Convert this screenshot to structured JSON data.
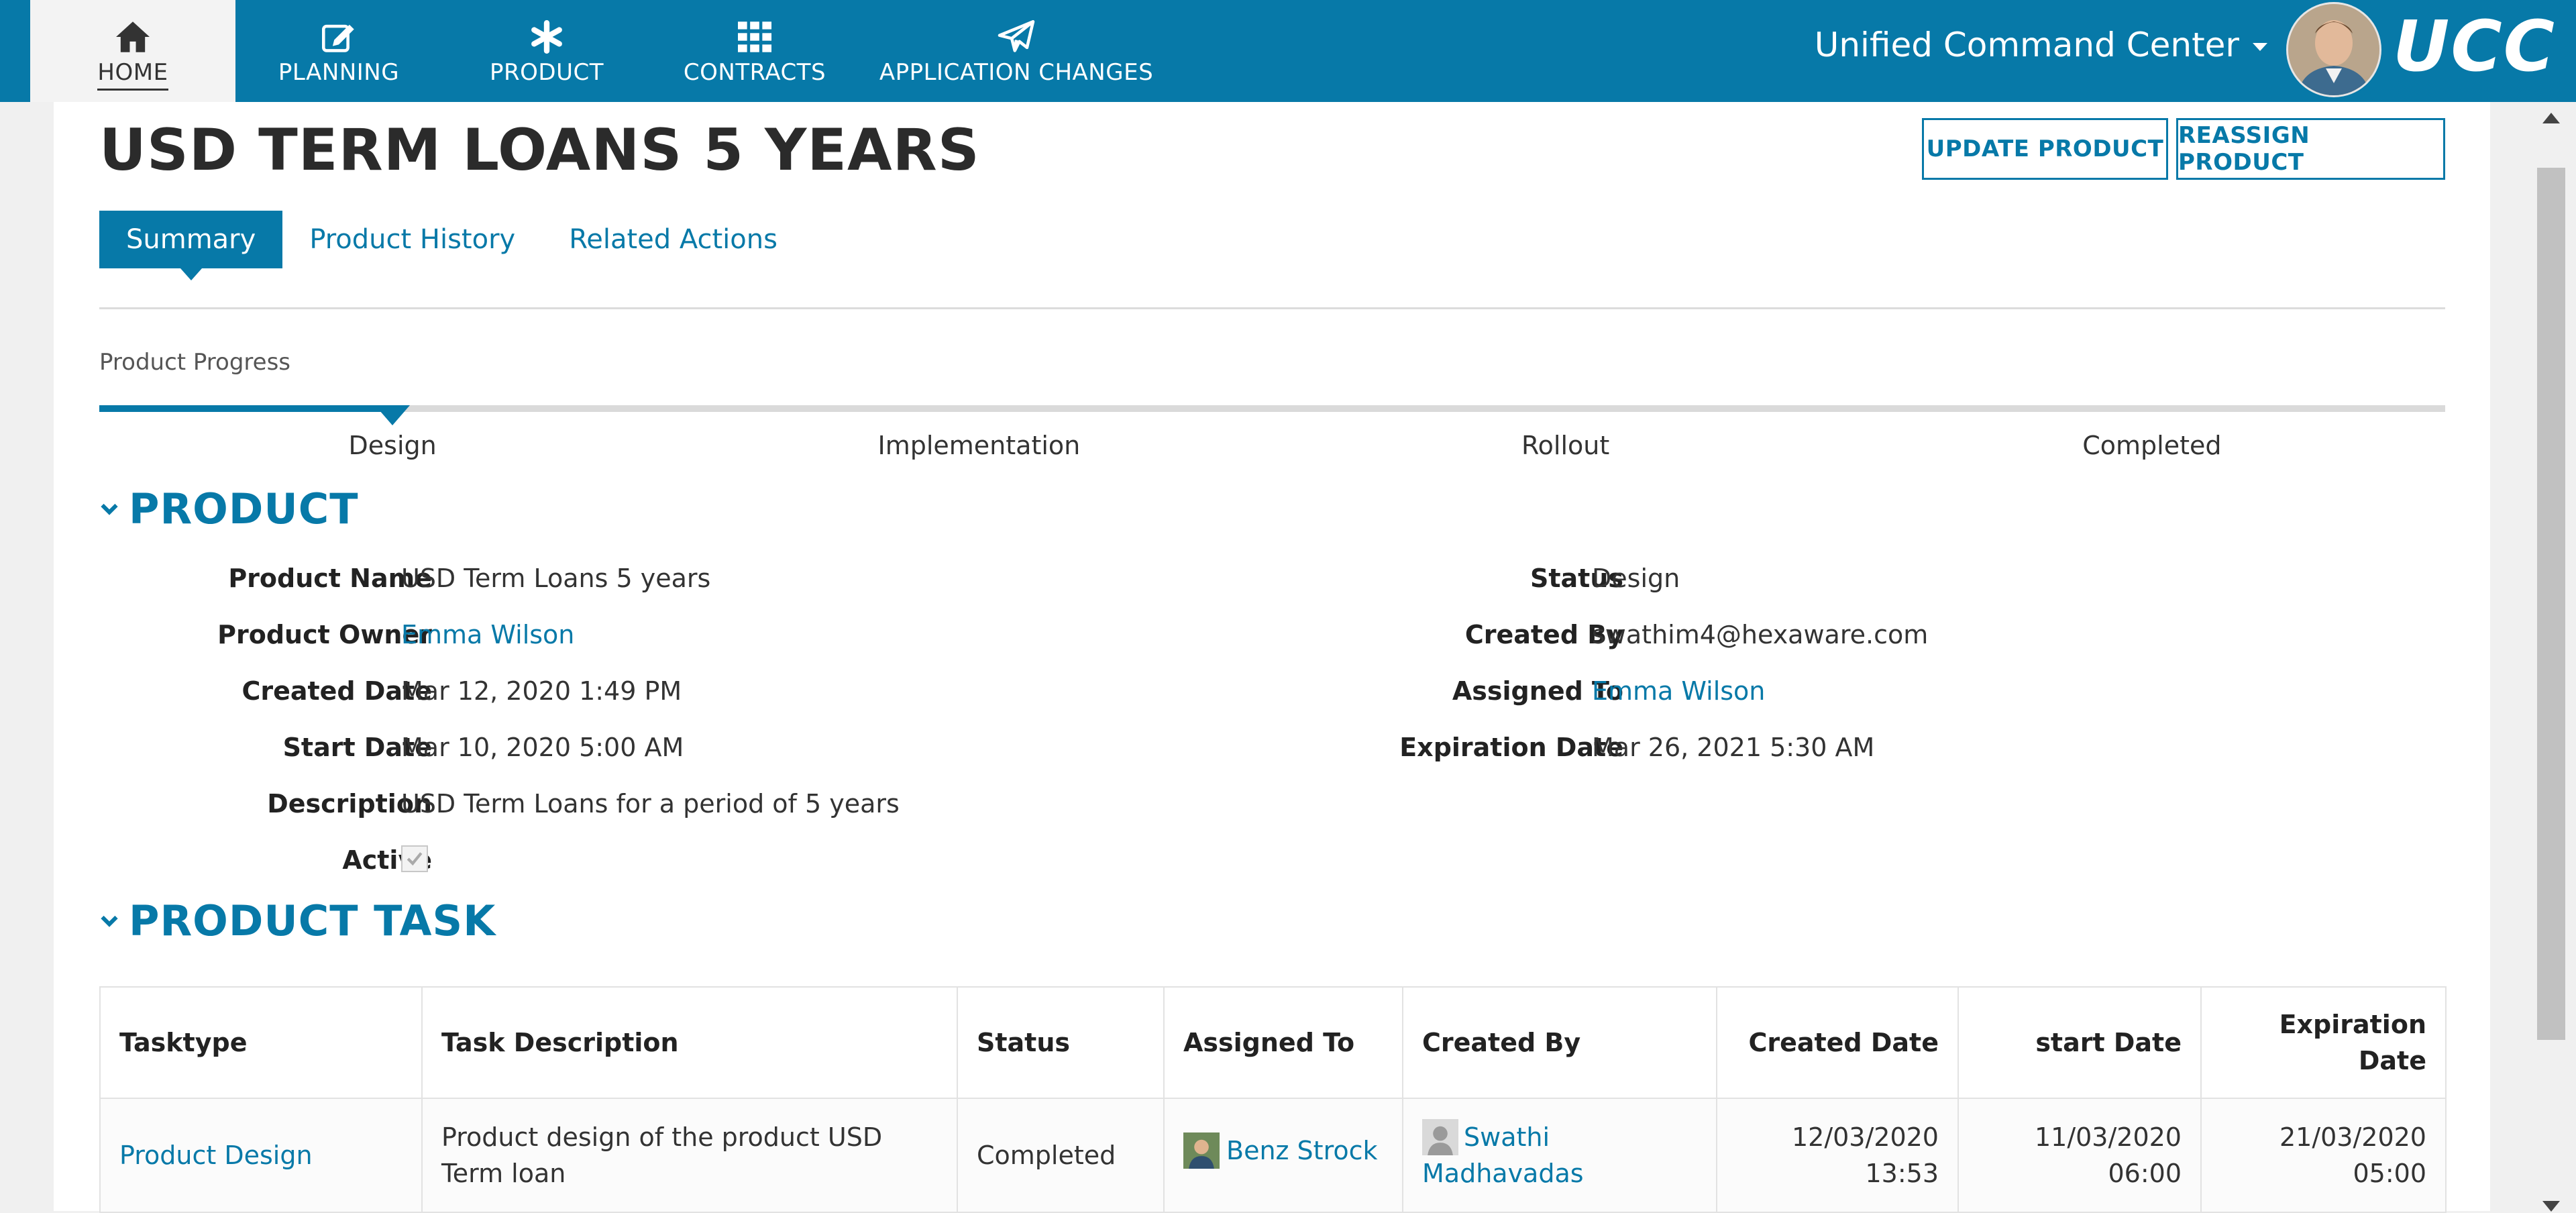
{
  "nav": {
    "items": [
      {
        "label": "HOME",
        "icon": "home-icon",
        "active": true
      },
      {
        "label": "PLANNING",
        "icon": "edit-icon",
        "active": false
      },
      {
        "label": "PRODUCT",
        "icon": "asterisk-icon",
        "active": false
      },
      {
        "label": "CONTRACTS",
        "icon": "grid-icon",
        "active": false
      },
      {
        "label": "APPLICATION CHANGES",
        "icon": "paper-plane-icon",
        "active": false
      }
    ],
    "app_title": "Unified Command Center",
    "logo": "UCC"
  },
  "page": {
    "title": "USD TERM LOANS 5 YEARS",
    "update_button": "UPDATE PRODUCT",
    "reassign_button": "REASSIGN PRODUCT",
    "tabs": [
      "Summary",
      "Product History",
      "Related Actions"
    ],
    "progress_label": "Product Progress",
    "stages": [
      "Design",
      "Implementation",
      "Rollout",
      "Completed"
    ],
    "current_stage_index": 0
  },
  "product": {
    "heading": "PRODUCT",
    "left": [
      {
        "label": "Product Name",
        "value": "USD Term Loans 5 years",
        "link": false
      },
      {
        "label": "Product Owner",
        "value": "Emma Wilson",
        "link": true
      },
      {
        "label": "Created Date",
        "value": "Mar 12, 2020 1:49 PM",
        "link": false
      },
      {
        "label": "Start Date",
        "value": "Mar 10, 2020 5:00 AM",
        "link": false
      },
      {
        "label": "Description",
        "value": "USD Term Loans for a period of 5 years",
        "link": false
      }
    ],
    "active_label": "Active",
    "active_checked": true,
    "right": [
      {
        "label": "Status",
        "value": "Design",
        "link": false
      },
      {
        "label": "Created By",
        "value": "swathim4@hexaware.com",
        "link": false
      },
      {
        "label": "Assigned To",
        "value": "Emma Wilson",
        "link": true
      },
      {
        "label": "Expiration Date",
        "value": "Mar 26, 2021 5:30 AM",
        "link": false
      }
    ]
  },
  "task": {
    "heading": "PRODUCT TASK",
    "columns": [
      "Tasktype",
      "Task Description",
      "Status",
      "Assigned To",
      "Created By",
      "Created Date",
      "start Date",
      "Expiration Date"
    ],
    "rows": [
      {
        "tasktype": "Product Design",
        "description": "Product design of the product USD Term loan",
        "status": "Completed",
        "assigned_to": "Benz Strock",
        "created_by": "Swathi Madhavadas",
        "created_date": "12/03/2020 13:53",
        "start_date": "11/03/2020 06:00",
        "expiration_date": "21/03/2020 05:00"
      }
    ]
  },
  "colors": {
    "brand": "#0779a8",
    "nav_bg": "#0779a8",
    "page_bg": "#f0f0f0"
  }
}
